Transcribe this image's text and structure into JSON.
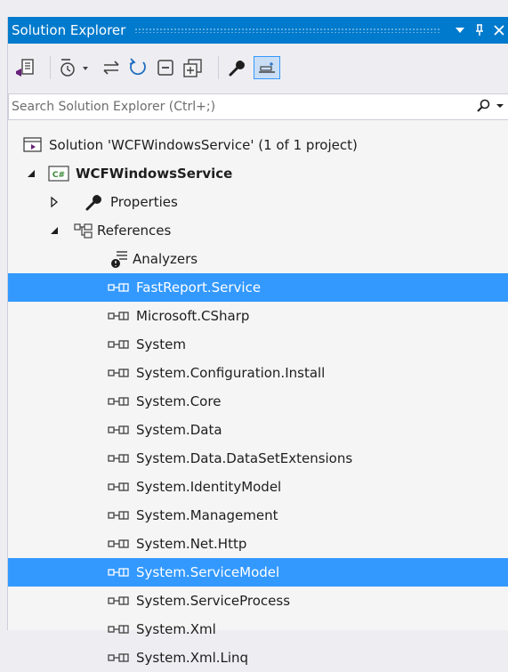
{
  "title": "Solution Explorer",
  "title_buttons": {
    "dropdown": "▼",
    "pin": "⊥",
    "close": "✕"
  },
  "search": {
    "placeholder": "Search Solution Explorer (Ctrl+;)"
  },
  "tree": {
    "solution": "Solution 'WCFWindowsService' (1 of 1 project)",
    "project": "WCFWindowsService",
    "properties": "Properties",
    "references": "References",
    "analyzers": "Analyzers",
    "refs": [
      {
        "label": "FastReport.Service",
        "selected": true
      },
      {
        "label": "Microsoft.CSharp",
        "selected": false
      },
      {
        "label": "System",
        "selected": false
      },
      {
        "label": "System.Configuration.Install",
        "selected": false
      },
      {
        "label": "System.Core",
        "selected": false
      },
      {
        "label": "System.Data",
        "selected": false
      },
      {
        "label": "System.Data.DataSetExtensions",
        "selected": false
      },
      {
        "label": "System.IdentityModel",
        "selected": false
      },
      {
        "label": "System.Management",
        "selected": false
      },
      {
        "label": "System.Net.Http",
        "selected": false
      },
      {
        "label": "System.ServiceModel",
        "selected": true
      },
      {
        "label": "System.ServiceProcess",
        "selected": false
      },
      {
        "label": "System.Xml",
        "selected": false
      },
      {
        "label": "System.Xml.Linq",
        "selected": false
      }
    ]
  },
  "icons": {
    "toolbar": [
      "sync-with-document-icon",
      "pending-changes-filter-icon",
      "back-forward-icon",
      "refresh-icon",
      "collapse-all-icon",
      "show-all-files-icon",
      "properties-wrench-icon",
      "preview-selected-items-icon"
    ],
    "search": "search-icon"
  },
  "colors": {
    "accent": "#007acc",
    "selection": "#3399ff",
    "panel": "#f5f5f5"
  }
}
